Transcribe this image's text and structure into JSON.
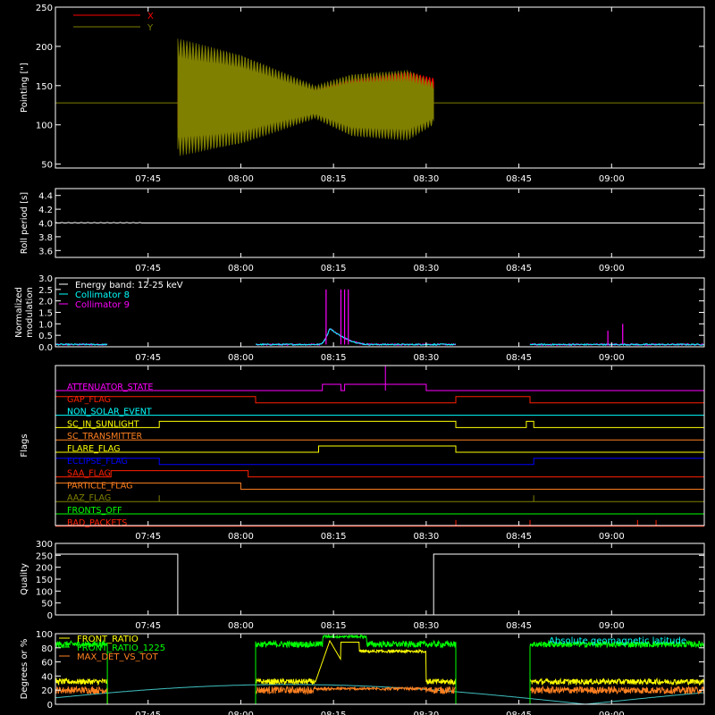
{
  "colors": {
    "background": "#000000",
    "axis": "#ffffff",
    "x_series": "#ff0000",
    "y_series": "#808000",
    "white": "#ffffff",
    "cyan": "#00ffff",
    "magenta": "#ff00ff",
    "green": "#00ff00",
    "orange": "#ff8020",
    "yellow": "#ffff00",
    "blue": "#0000ff",
    "red": "#ff0000",
    "dim_cyan": "#40c0c0"
  },
  "time_axis": {
    "range_hours": [
      7.5,
      9.25
    ],
    "ticks": [
      {
        "label": "07:45",
        "hours": 7.75
      },
      {
        "label": "08:00",
        "hours": 8.0
      },
      {
        "label": "08:15",
        "hours": 8.25
      },
      {
        "label": "08:30",
        "hours": 8.5
      },
      {
        "label": "08:45",
        "hours": 8.75
      },
      {
        "label": "09:00",
        "hours": 9.0
      }
    ]
  },
  "chart_data": [
    {
      "id": "pointing",
      "type": "area",
      "ylabel": "Pointing [\"]",
      "ylim": [
        45,
        250
      ],
      "yticks": [
        50,
        100,
        150,
        200,
        250
      ],
      "legend": {
        "placement": "top-left",
        "entries": [
          {
            "name": "X",
            "color": "#ff0000"
          },
          {
            "name": "Y",
            "color": "#808000"
          }
        ]
      },
      "baseline": 128,
      "data_range_hours": [
        7.83,
        8.52
      ],
      "series": [
        {
          "name": "X",
          "color": "#ff0000",
          "envelope": [
            {
              "t": 7.83,
              "min": 95,
              "max": 165
            },
            {
              "t": 8.0,
              "min": 105,
              "max": 155
            },
            {
              "t": 8.2,
              "min": 115,
              "max": 145
            },
            {
              "t": 8.3,
              "min": 105,
              "max": 158
            },
            {
              "t": 8.45,
              "min": 95,
              "max": 168
            },
            {
              "t": 8.52,
              "min": 110,
              "max": 160
            }
          ]
        },
        {
          "name": "Y",
          "color": "#808000",
          "envelope": [
            {
              "t": 7.83,
              "min": 60,
              "max": 210
            },
            {
              "t": 8.0,
              "min": 75,
              "max": 190
            },
            {
              "t": 8.2,
              "min": 108,
              "max": 150
            },
            {
              "t": 8.3,
              "min": 85,
              "max": 165
            },
            {
              "t": 8.45,
              "min": 80,
              "max": 170
            },
            {
              "t": 8.52,
              "min": 100,
              "max": 155
            }
          ]
        }
      ]
    },
    {
      "id": "roll_period",
      "type": "line",
      "ylabel": "Roll period [s]",
      "ylim": [
        3.5,
        4.5
      ],
      "yticks": [
        3.6,
        3.8,
        4.0,
        4.2,
        4.4
      ],
      "series": [
        {
          "name": "",
          "color": "#ffffff",
          "y": 4.0
        }
      ]
    },
    {
      "id": "modulation",
      "type": "line",
      "ylabel_lines": [
        "Normalized",
        "modulation"
      ],
      "ylim": [
        0.0,
        3.0
      ],
      "yticks": [
        0.0,
        0.5,
        1.0,
        1.5,
        2.0,
        2.5,
        3.0
      ],
      "legend": {
        "placement": "top-left",
        "entries": [
          {
            "name": "Energy band: 12-25 keV",
            "color": "#ffffff"
          },
          {
            "name": "Collimator 8",
            "color": "#00ffff"
          },
          {
            "name": "Collimator 9",
            "color": "#ff00ff"
          }
        ]
      },
      "data_segments_hours": [
        [
          7.5,
          7.64
        ],
        [
          8.04,
          8.58
        ],
        [
          8.78,
          9.25
        ]
      ],
      "baseline": 0.1,
      "bump": {
        "t0": 8.21,
        "t1": 8.35,
        "peak_t": 8.24,
        "peak": 0.8
      },
      "spikes": [
        {
          "t": 8.23,
          "value": 2.5,
          "color": "#ff00ff"
        },
        {
          "t": 8.27,
          "value": 2.5,
          "color": "#ff00ff"
        },
        {
          "t": 8.28,
          "value": 2.5,
          "color": "#ff00ff"
        },
        {
          "t": 8.29,
          "value": 2.5,
          "color": "#ff00ff"
        },
        {
          "t": 8.99,
          "value": 0.7,
          "color": "#ff00ff"
        },
        {
          "t": 9.03,
          "value": 1.0,
          "color": "#ff00ff"
        }
      ]
    },
    {
      "id": "flags",
      "type": "step",
      "ylabel": "Flags",
      "rows": [
        {
          "name": "ATTENUATOR_STATE",
          "color": "#ff00ff",
          "on": [
            [
              8.22,
              8.27
            ],
            [
              8.28,
              8.5
            ]
          ],
          "spikes": [
            8.39
          ]
        },
        {
          "name": "GAP_FLAG",
          "color": "#ff2000",
          "on": [
            [
              7.5,
              8.04
            ],
            [
              8.58,
              8.78
            ]
          ]
        },
        {
          "name": "NON_SOLAR_EVENT",
          "color": "#00ffff",
          "on": []
        },
        {
          "name": "SC_IN_SUNLIGHT",
          "color": "#ffff00",
          "on": [
            [
              7.78,
              8.58
            ],
            [
              8.77,
              8.79
            ]
          ]
        },
        {
          "name": "SC_TRANSMITTER",
          "color": "#ff8020",
          "on": []
        },
        {
          "name": "FLARE_FLAG",
          "color": "#ffff00",
          "on": [
            [
              8.21,
              8.58
            ]
          ]
        },
        {
          "name": "ECLIPSE_FLAG",
          "color": "#0000ff",
          "on": [
            [
              7.5,
              7.78
            ],
            [
              8.79,
              9.25
            ]
          ]
        },
        {
          "name": "SAA_FLAG",
          "color": "#ff2000",
          "on": [
            [
              7.65,
              8.02
            ]
          ]
        },
        {
          "name": "PARTICLE_FLAG",
          "color": "#ff8020",
          "on": [
            [
              7.5,
              8.0
            ]
          ]
        },
        {
          "name": "AAZ_FLAG",
          "color": "#808000",
          "on": [],
          "spikes": [
            7.78,
            8.79
          ]
        },
        {
          "name": "FRONTS_OFF",
          "color": "#00ff00",
          "on": []
        },
        {
          "name": "BAD_PACKETS",
          "color": "#ff2000",
          "on": [],
          "spikes": [
            8.58,
            8.78,
            9.07,
            9.12
          ]
        }
      ]
    },
    {
      "id": "quality",
      "type": "step",
      "ylabel": "Quality",
      "ylim": [
        0,
        300
      ],
      "yticks": [
        0,
        50,
        100,
        150,
        200,
        250,
        300
      ],
      "series": [
        {
          "name": "",
          "color": "#ffffff",
          "steps": [
            [
              7.5,
              255
            ],
            [
              7.83,
              0
            ],
            [
              8.52,
              255
            ],
            [
              9.25,
              255
            ]
          ]
        }
      ]
    },
    {
      "id": "front_ratio",
      "type": "line",
      "ylabel": "Degrees or %",
      "ylim": [
        0,
        100
      ],
      "yticks": [
        0,
        20,
        40,
        60,
        80,
        100
      ],
      "legend": {
        "placement": "top-left",
        "entries": [
          {
            "name": "FRONT_RATIO",
            "color": "#ffff00"
          },
          {
            "name": "FRONT_RATIO_1225",
            "color": "#00ff00"
          },
          {
            "name": "MAX_DET_VS_TOT",
            "color": "#ff8020"
          }
        ]
      },
      "annotation": {
        "text": "Absolute geomagnetic latitude",
        "color": "#00ffff",
        "placement": "top-right"
      },
      "data_segments_hours": [
        [
          7.5,
          7.64
        ],
        [
          8.04,
          8.58
        ],
        [
          8.78,
          9.25
        ]
      ],
      "front_ratio_1225_level": 85,
      "front_ratio_level": 32,
      "max_det_level": 20,
      "latitude": {
        "period_hours": 1.6,
        "min": 0,
        "max": 28,
        "phase_hours": 7.33
      }
    }
  ]
}
